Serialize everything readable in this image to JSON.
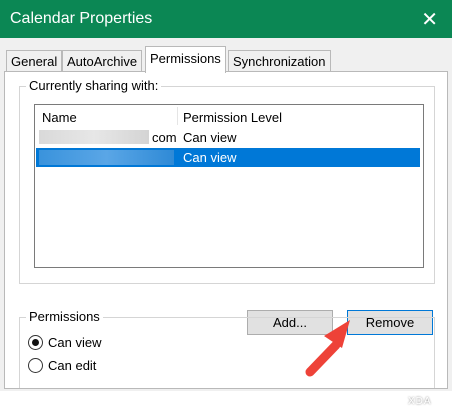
{
  "window": {
    "title": "Calendar Properties",
    "close_glyph": "✕",
    "titlebar_color": "#0b8754"
  },
  "tabs": [
    {
      "label": "General"
    },
    {
      "label": "AutoArchive"
    },
    {
      "label": "Permissions",
      "active": true
    },
    {
      "label": "Synchronization"
    }
  ],
  "sharing": {
    "group_label": "Currently sharing with:",
    "columns": [
      "Name",
      "Permission Level"
    ],
    "rows": [
      {
        "name_suffix": "com",
        "permission": "Can view",
        "selected": false
      },
      {
        "name_suffix": "",
        "permission": "Can view",
        "selected": true
      }
    ],
    "selection_color": "#0078d7"
  },
  "buttons": {
    "add": "Add...",
    "remove": "Remove"
  },
  "permissions": {
    "group_label": "Permissions",
    "options": [
      {
        "label": "Can view",
        "checked": true
      },
      {
        "label": "Can edit",
        "checked": false
      }
    ]
  },
  "watermark": "XDA",
  "arrow_color": "#ee4238"
}
